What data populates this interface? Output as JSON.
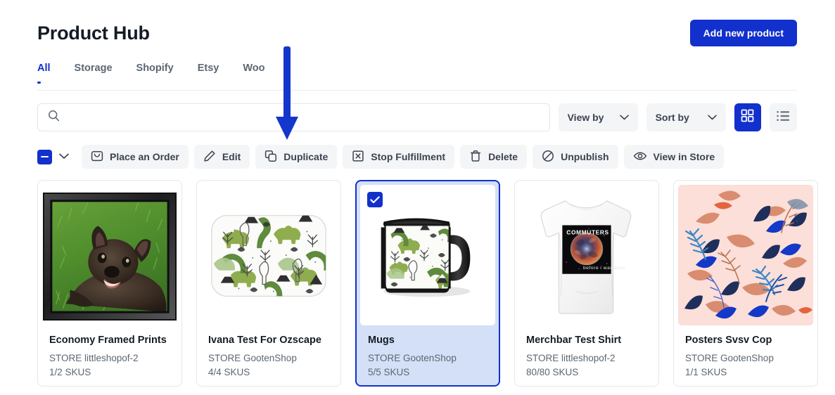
{
  "header": {
    "title": "Product Hub",
    "add_button_label": "Add new product"
  },
  "tabs": [
    {
      "label": "All",
      "active": true
    },
    {
      "label": "Storage",
      "active": false
    },
    {
      "label": "Shopify",
      "active": false
    },
    {
      "label": "Etsy",
      "active": false
    },
    {
      "label": "Woo",
      "active": false
    }
  ],
  "filters": {
    "search": {
      "value": "",
      "placeholder": "",
      "icon": "search-icon"
    },
    "view_by": {
      "label": "View by",
      "icon": "chevron-down-icon"
    },
    "sort_by": {
      "label": "Sort by",
      "icon": "chevron-down-icon"
    },
    "view_modes": [
      {
        "name": "grid-view",
        "icon": "grid-icon",
        "active": true
      },
      {
        "name": "list-view",
        "icon": "list-icon",
        "active": false
      }
    ]
  },
  "toolbar": {
    "select_all": {
      "state": "indeterminate",
      "icon": "minus-icon",
      "chevron": "chevron-down-icon"
    },
    "actions": [
      {
        "label": "Place an Order",
        "icon": "bag-icon"
      },
      {
        "label": "Edit",
        "icon": "pencil-icon"
      },
      {
        "label": "Duplicate",
        "icon": "copy-icon"
      },
      {
        "label": "Stop Fulfillment",
        "icon": "x-box-icon"
      },
      {
        "label": "Delete",
        "icon": "trash-icon"
      },
      {
        "label": "Unpublish",
        "icon": "no-entry-icon"
      },
      {
        "label": "View in Store",
        "icon": "eye-icon"
      }
    ]
  },
  "products": [
    {
      "title": "Economy Framed Prints",
      "store": "STORE littleshopof-2",
      "skus": "1/2 SKUS",
      "selected": false,
      "art": "framed-dog-photo"
    },
    {
      "title": "Ivana Test For Ozscape",
      "store": "STORE GootenShop",
      "skus": "4/4 SKUS",
      "selected": false,
      "art": "dinosaur-blanket"
    },
    {
      "title": "Mugs",
      "store": "STORE GootenShop",
      "skus": "5/5 SKUS",
      "selected": true,
      "art": "dinosaur-mug"
    },
    {
      "title": "Merchbar Test Shirt",
      "store": "STORE littleshopof-2",
      "skus": "80/80 SKUS",
      "selected": false,
      "art": "commuters-tshirt",
      "art_text": {
        "band": "COMMUTERS",
        "album": "before i was born"
      }
    },
    {
      "title": "Posters Svsv Cop",
      "store": "STORE GootenShop",
      "skus": "1/1 SKUS",
      "selected": false,
      "art": "botanical-poster"
    }
  ],
  "annotation": {
    "type": "arrow-down",
    "points_to": "Duplicate",
    "color": "#1230CC"
  },
  "colors": {
    "accent": "#1230CC",
    "selected_card_bg": "#d3e0f7",
    "muted_text": "#5c6672",
    "chip_bg": "#f4f5f7"
  }
}
